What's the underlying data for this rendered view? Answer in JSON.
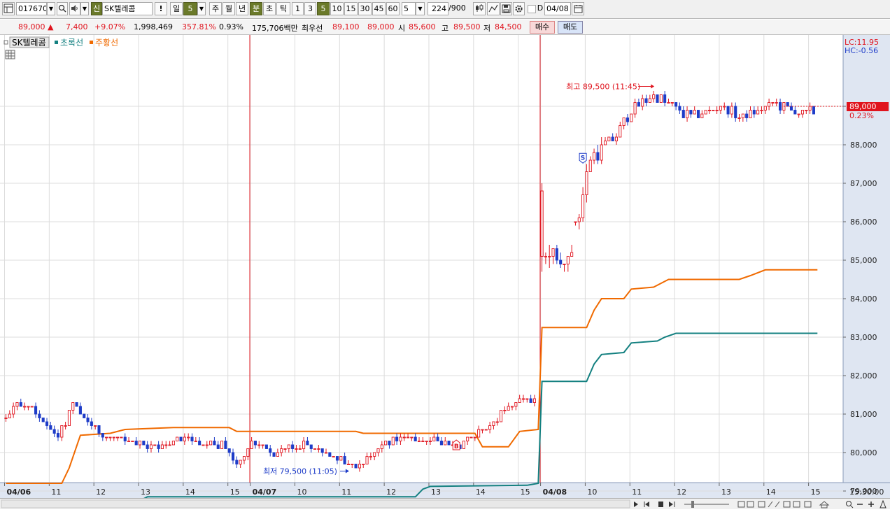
{
  "toolbar": {
    "code": "017670",
    "stock_badge": "신",
    "stock_name": "SK텔레콤",
    "alert": "!",
    "day_label": "일",
    "day_value": "5",
    "periods": [
      "주",
      "월",
      "년",
      "분",
      "초",
      "틱"
    ],
    "minutes": [
      "1",
      "3",
      "5",
      "10",
      "15",
      "30",
      "45",
      "60"
    ],
    "custom_value": "5",
    "count": "224",
    "count_total": "/900",
    "date_check": "D",
    "date": "04/08"
  },
  "quote": {
    "price": "89,000 ▲",
    "change": "7,400",
    "change_pct": "+9.07%",
    "volume": "1,998,469",
    "volume_ratio": "357.81%",
    "turnover": "0.93%",
    "amount": "175,706백만",
    "best_label": "최우선",
    "ask": "89,100",
    "bid": "89,000",
    "open_label": "시",
    "open": "85,600",
    "high_label": "고",
    "high": "89,500",
    "low_label": "저",
    "low": "84,500",
    "buy_button": "매수",
    "sell_button": "매도"
  },
  "legend": {
    "symbol": "SK텔레콤",
    "line1": "초록선",
    "line2": "주황선"
  },
  "colors": {
    "up": "#e0141e",
    "down": "#1e3cc8",
    "teal": "#138080",
    "orange": "#f06a00",
    "grid": "#dcdcdc",
    "axis_bg": "#dfe6f2"
  },
  "chart_data": {
    "type": "candlestick",
    "interval_minutes": 5,
    "ylim": [
      78500,
      90500
    ],
    "y_ticks": [
      79000,
      80000,
      81000,
      82000,
      83000,
      84000,
      85000,
      86000,
      87000,
      88000,
      89000
    ],
    "y_tick_labels": [
      "79,000",
      "80,000",
      "81,000",
      "82,000",
      "83,000",
      "84,000",
      "85,000",
      "86,000",
      "87,000",
      "88,000",
      "89,000"
    ],
    "right_info": {
      "lc": "LC:11.95",
      "hc": "HC:-0.56",
      "last_price": "89,000",
      "last_pct": "0.23%",
      "last_value": 89000
    },
    "x_labels": [
      {
        "bar": 0,
        "label": "04/06"
      },
      {
        "bar": 12,
        "label": "11"
      },
      {
        "bar": 24,
        "label": "12"
      },
      {
        "bar": 36,
        "label": "13"
      },
      {
        "bar": 48,
        "label": "14"
      },
      {
        "bar": 60,
        "label": "15"
      },
      {
        "bar": 66,
        "label": "04/07"
      },
      {
        "bar": 78,
        "label": "10"
      },
      {
        "bar": 90,
        "label": "11"
      },
      {
        "bar": 102,
        "label": "12"
      },
      {
        "bar": 114,
        "label": "13"
      },
      {
        "bar": 126,
        "label": "14"
      },
      {
        "bar": 138,
        "label": "15"
      },
      {
        "bar": 144,
        "label": "04/08"
      },
      {
        "bar": 156,
        "label": "10"
      },
      {
        "bar": 168,
        "label": "11"
      },
      {
        "bar": 180,
        "label": "12"
      },
      {
        "bar": 192,
        "label": "13"
      },
      {
        "bar": 204,
        "label": "14"
      },
      {
        "bar": 216,
        "label": "15"
      }
    ],
    "x_right_label": "15:30:00",
    "day_separators": [
      66,
      144
    ],
    "annotations": {
      "high": {
        "text": "최고 89,500 (11:45)",
        "bar": 174,
        "value": 89500
      },
      "low": {
        "text": "최저 79,500 (11:05)",
        "bar": 92,
        "value": 79500
      },
      "sell_signal": {
        "text": "S",
        "bar": 155,
        "value": 87650
      },
      "buy_signal": {
        "text": "B",
        "bar": 121,
        "value": 80200
      }
    },
    "segments": [
      {
        "from": 0,
        "to": 4,
        "start": 80900,
        "end": 81300,
        "amp": 120
      },
      {
        "from": 4,
        "to": 10,
        "start": 81300,
        "end": 80900,
        "amp": 120
      },
      {
        "from": 10,
        "to": 14,
        "start": 80900,
        "end": 80400,
        "amp": 110
      },
      {
        "from": 14,
        "to": 18,
        "start": 80400,
        "end": 81300,
        "amp": 130
      },
      {
        "from": 18,
        "to": 25,
        "start": 81300,
        "end": 80500,
        "amp": 110
      },
      {
        "from": 25,
        "to": 40,
        "start": 80500,
        "end": 80100,
        "amp": 90
      },
      {
        "from": 40,
        "to": 48,
        "start": 80100,
        "end": 80400,
        "amp": 100
      },
      {
        "from": 48,
        "to": 58,
        "start": 80400,
        "end": 80200,
        "amp": 110
      },
      {
        "from": 58,
        "to": 62,
        "start": 80200,
        "end": 79700,
        "amp": 120
      },
      {
        "from": 62,
        "to": 66,
        "start": 79700,
        "end": 80300,
        "amp": 110
      },
      {
        "from": 66,
        "to": 72,
        "start": 80300,
        "end": 80000,
        "amp": 100
      },
      {
        "from": 72,
        "to": 80,
        "start": 80000,
        "end": 80200,
        "amp": 90
      },
      {
        "from": 80,
        "to": 90,
        "start": 80200,
        "end": 79800,
        "amp": 90
      },
      {
        "from": 90,
        "to": 94,
        "start": 79800,
        "end": 79600,
        "amp": 90
      },
      {
        "from": 94,
        "to": 104,
        "start": 79600,
        "end": 80400,
        "amp": 100
      },
      {
        "from": 104,
        "to": 116,
        "start": 80400,
        "end": 80300,
        "amp": 80
      },
      {
        "from": 116,
        "to": 122,
        "start": 80300,
        "end": 80200,
        "amp": 80
      },
      {
        "from": 122,
        "to": 128,
        "start": 80200,
        "end": 80600,
        "amp": 100
      },
      {
        "from": 128,
        "to": 136,
        "start": 80600,
        "end": 81300,
        "amp": 130
      },
      {
        "from": 136,
        "to": 143,
        "start": 81300,
        "end": 81400,
        "amp": 110
      },
      {
        "from": 144,
        "to": 148,
        "start": 85200,
        "end": 84900,
        "amp": 300
      },
      {
        "from": 148,
        "to": 152,
        "start": 84900,
        "end": 85300,
        "amp": 200
      },
      {
        "from": 152,
        "to": 157,
        "start": 85300,
        "end": 87700,
        "amp": 220
      },
      {
        "from": 157,
        "to": 163,
        "start": 87700,
        "end": 88100,
        "amp": 200
      },
      {
        "from": 163,
        "to": 168,
        "start": 88100,
        "end": 88900,
        "amp": 160
      },
      {
        "from": 168,
        "to": 174,
        "start": 88900,
        "end": 89300,
        "amp": 120
      },
      {
        "from": 174,
        "to": 184,
        "start": 89300,
        "end": 88700,
        "amp": 130
      },
      {
        "from": 184,
        "to": 192,
        "start": 88700,
        "end": 89000,
        "amp": 120
      },
      {
        "from": 192,
        "to": 198,
        "start": 89000,
        "end": 88700,
        "amp": 120
      },
      {
        "from": 198,
        "to": 206,
        "start": 88700,
        "end": 89100,
        "amp": 120
      },
      {
        "from": 206,
        "to": 213,
        "start": 89100,
        "end": 88800,
        "amp": 110
      },
      {
        "from": 213,
        "to": 218,
        "start": 88800,
        "end": 88900,
        "amp": 110
      }
    ],
    "series": [
      {
        "name": "초록선",
        "color": "#138080",
        "steps": [
          [
            0,
            78650
          ],
          [
            1,
            78650
          ],
          [
            34,
            78650
          ],
          [
            36,
            78750
          ],
          [
            38,
            78850
          ],
          [
            92,
            78850
          ],
          [
            110,
            78850
          ],
          [
            112,
            79050
          ],
          [
            114,
            79120
          ],
          [
            140,
            79150
          ],
          [
            143,
            79200
          ],
          [
            144,
            81850
          ],
          [
            156,
            81850
          ],
          [
            158,
            82300
          ],
          [
            160,
            82550
          ],
          [
            166,
            82600
          ],
          [
            168,
            82850
          ],
          [
            175,
            82900
          ],
          [
            177,
            83000
          ],
          [
            180,
            83100
          ],
          [
            218,
            83100
          ]
        ]
      },
      {
        "name": "주황선",
        "color": "#f06a00",
        "steps": [
          [
            0,
            79200
          ],
          [
            1,
            79200
          ],
          [
            15,
            79200
          ],
          [
            17,
            79600
          ],
          [
            20,
            80450
          ],
          [
            28,
            80500
          ],
          [
            32,
            80600
          ],
          [
            45,
            80650
          ],
          [
            60,
            80650
          ],
          [
            62,
            80550
          ],
          [
            94,
            80550
          ],
          [
            96,
            80500
          ],
          [
            126,
            80500
          ],
          [
            128,
            80150
          ],
          [
            135,
            80150
          ],
          [
            138,
            80550
          ],
          [
            143,
            80600
          ],
          [
            144,
            83250
          ],
          [
            156,
            83250
          ],
          [
            158,
            83700
          ],
          [
            160,
            84000
          ],
          [
            166,
            84000
          ],
          [
            168,
            84250
          ],
          [
            174,
            84300
          ],
          [
            176,
            84400
          ],
          [
            178,
            84500
          ],
          [
            197,
            84500
          ],
          [
            200,
            84600
          ],
          [
            204,
            84750
          ],
          [
            218,
            84750
          ]
        ]
      }
    ]
  }
}
